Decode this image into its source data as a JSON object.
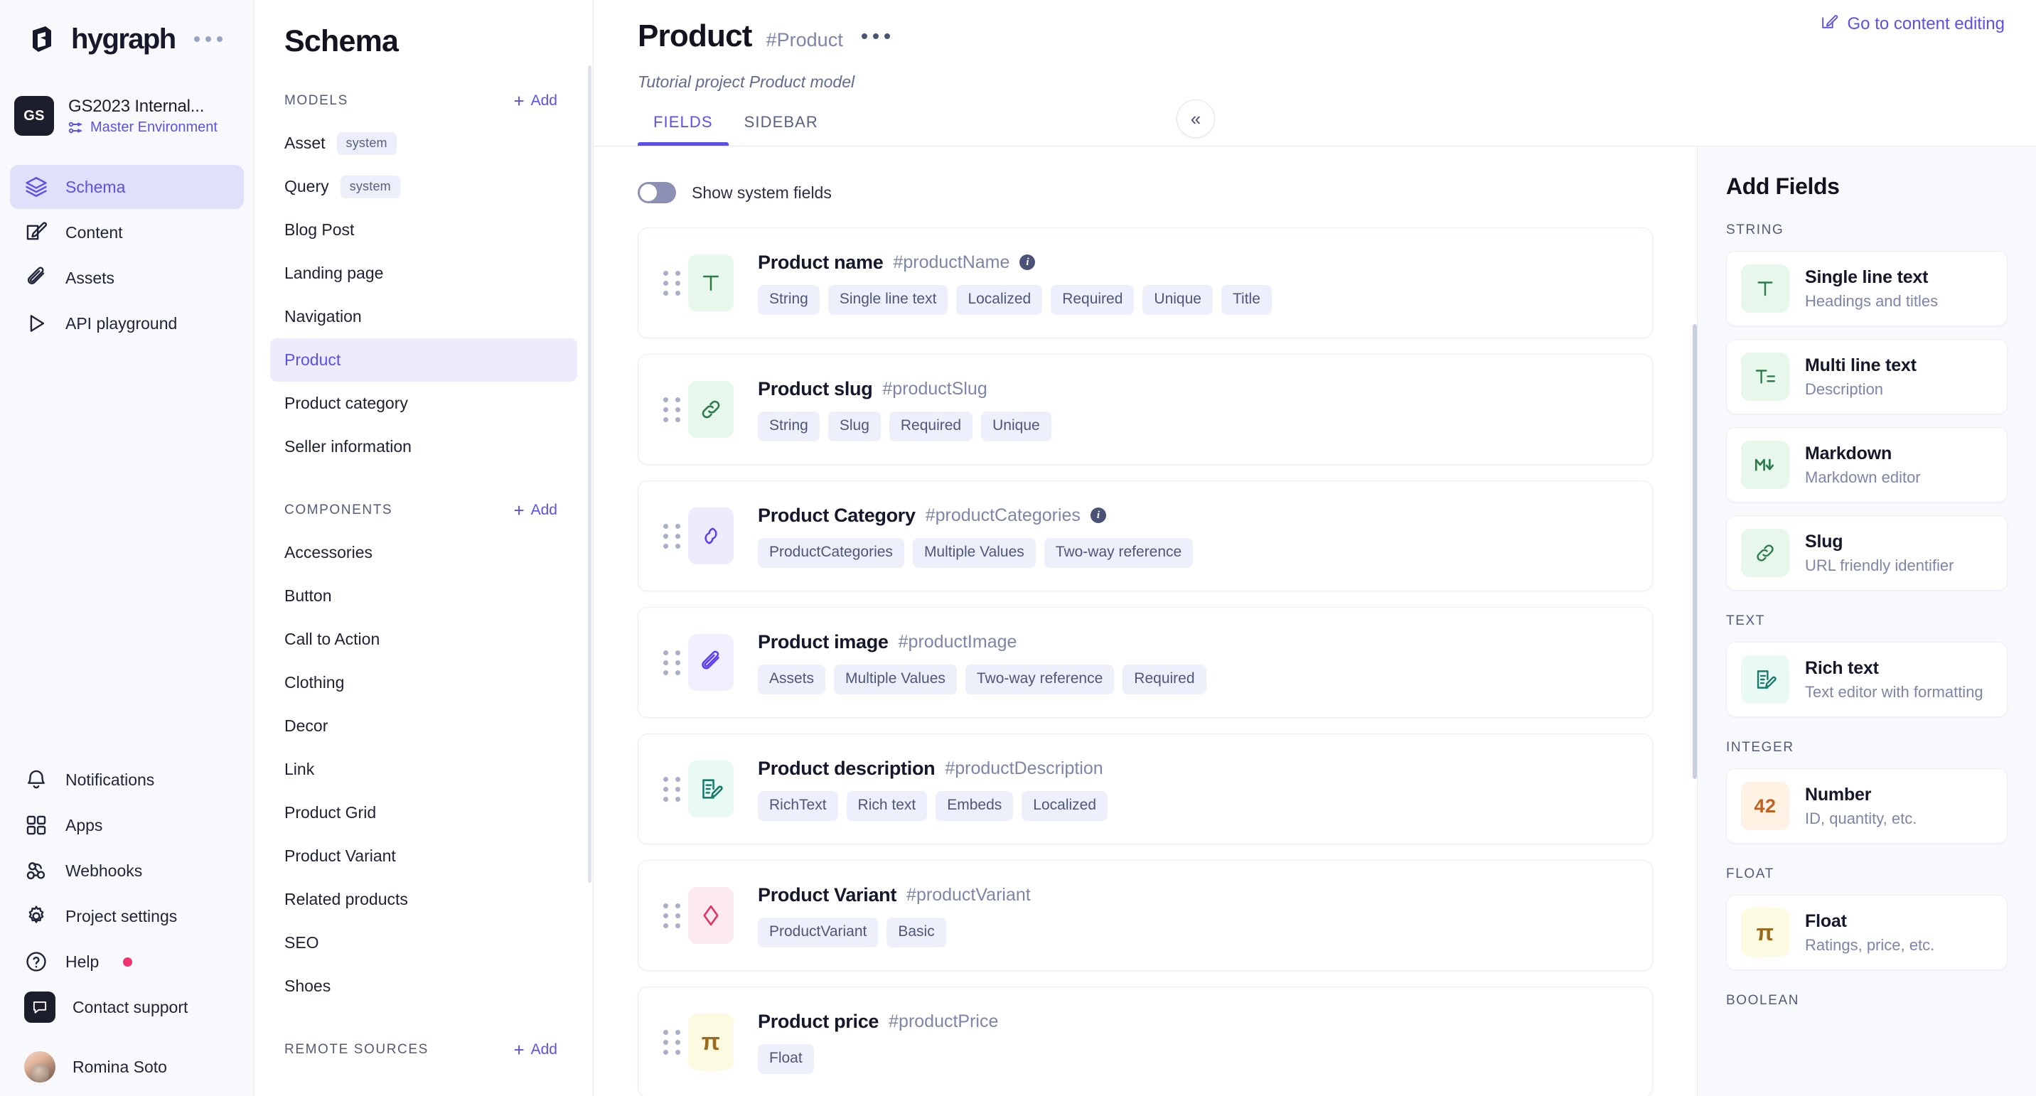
{
  "brand": {
    "name": "hygraph",
    "accent": "#5b51e8"
  },
  "project": {
    "initials": "GS",
    "name": "GS2023 Internal...",
    "environment": "Master Environment"
  },
  "nav_primary": [
    {
      "label": "Schema",
      "icon": "layers-icon",
      "active": true
    },
    {
      "label": "Content",
      "icon": "pencil-square-icon",
      "active": false
    },
    {
      "label": "Assets",
      "icon": "paperclip-icon",
      "active": false
    },
    {
      "label": "API playground",
      "icon": "play-icon",
      "active": false
    }
  ],
  "nav_secondary": [
    {
      "label": "Notifications",
      "icon": "bell-icon",
      "badge": false
    },
    {
      "label": "Apps",
      "icon": "grid-icon",
      "badge": false
    },
    {
      "label": "Webhooks",
      "icon": "webhook-icon",
      "badge": false
    },
    {
      "label": "Project settings",
      "icon": "gear-icon",
      "badge": false
    },
    {
      "label": "Help",
      "icon": "question-circle-icon",
      "badge": true
    },
    {
      "label": "Contact support",
      "icon": "chat-icon",
      "badge": false
    }
  ],
  "user": {
    "name": "Romina Soto"
  },
  "schema": {
    "title": "Schema",
    "groups": [
      {
        "label": "MODELS",
        "add_label": "Add",
        "items": [
          {
            "label": "Asset",
            "badge": "system",
            "active": false
          },
          {
            "label": "Query",
            "badge": "system",
            "active": false
          },
          {
            "label": "Blog Post",
            "badge": "",
            "active": false
          },
          {
            "label": "Landing page",
            "badge": "",
            "active": false
          },
          {
            "label": "Navigation",
            "badge": "",
            "active": false
          },
          {
            "label": "Product",
            "badge": "",
            "active": true
          },
          {
            "label": "Product category",
            "badge": "",
            "active": false
          },
          {
            "label": "Seller information",
            "badge": "",
            "active": false
          }
        ]
      },
      {
        "label": "COMPONENTS",
        "add_label": "Add",
        "items": [
          {
            "label": "Accessories",
            "badge": "",
            "active": false
          },
          {
            "label": "Button",
            "badge": "",
            "active": false
          },
          {
            "label": "Call to Action",
            "badge": "",
            "active": false
          },
          {
            "label": "Clothing",
            "badge": "",
            "active": false
          },
          {
            "label": "Decor",
            "badge": "",
            "active": false
          },
          {
            "label": "Link",
            "badge": "",
            "active": false
          },
          {
            "label": "Product Grid",
            "badge": "",
            "active": false
          },
          {
            "label": "Product Variant",
            "badge": "",
            "active": false
          },
          {
            "label": "Related products",
            "badge": "",
            "active": false
          },
          {
            "label": "SEO",
            "badge": "",
            "active": false
          },
          {
            "label": "Shoes",
            "badge": "",
            "active": false
          }
        ]
      },
      {
        "label": "REMOTE SOURCES",
        "add_label": "Add",
        "items": []
      }
    ]
  },
  "header": {
    "title": "Product",
    "api_id": "#Product",
    "description": "Tutorial project Product model",
    "content_link": "Go to content editing",
    "tabs": [
      {
        "label": "FIELDS",
        "active": true
      },
      {
        "label": "SIDEBAR",
        "active": false
      }
    ]
  },
  "fields_toolbar": {
    "show_system_fields_label": "Show system fields",
    "show_system_fields_on": false
  },
  "fields": [
    {
      "name": "Product name",
      "api_id": "#productName",
      "has_info": true,
      "icon": "text-t-icon",
      "icon_bg": "#e7f7ec",
      "icon_color": "#2f7a4d",
      "chips": [
        "String",
        "Single line text",
        "Localized",
        "Required",
        "Unique",
        "Title"
      ]
    },
    {
      "name": "Product slug",
      "api_id": "#productSlug",
      "has_info": false,
      "icon": "link-icon",
      "icon_bg": "#e7f7ec",
      "icon_color": "#2f7a4d",
      "chips": [
        "String",
        "Slug",
        "Required",
        "Unique"
      ]
    },
    {
      "name": "Product Category",
      "api_id": "#productCategories",
      "has_info": true,
      "icon": "reference-icon",
      "icon_bg": "#eeebfd",
      "icon_color": "#5b3df0",
      "chips": [
        "ProductCategories",
        "Multiple Values",
        "Two-way reference"
      ]
    },
    {
      "name": "Product image",
      "api_id": "#productImage",
      "has_info": false,
      "icon": "paperclip-icon",
      "icon_bg": "#f1effd",
      "icon_color": "#5b3df0",
      "chips": [
        "Assets",
        "Multiple Values",
        "Two-way reference",
        "Required"
      ]
    },
    {
      "name": "Product description",
      "api_id": "#productDescription",
      "has_info": false,
      "icon": "richtext-icon",
      "icon_bg": "#e8faf3",
      "icon_color": "#177a6a",
      "chips": [
        "RichText",
        "Rich text",
        "Embeds",
        "Localized"
      ]
    },
    {
      "name": "Product Variant",
      "api_id": "#productVariant",
      "has_info": false,
      "icon": "diamond-icon",
      "icon_bg": "#fdeaf0",
      "icon_color": "#e0315f",
      "chips": [
        "ProductVariant",
        "Basic"
      ]
    },
    {
      "name": "Product price",
      "api_id": "#productPrice",
      "has_info": false,
      "icon": "pi-icon",
      "icon_bg": "#fcfbe2",
      "icon_color": "#9a6b1e",
      "chips": [
        "Float"
      ]
    }
  ],
  "add_fields": {
    "title": "Add Fields",
    "groups": [
      {
        "label": "STRING",
        "cards": [
          {
            "name": "Single line text",
            "sub": "Headings and titles",
            "icon": "text-t-icon",
            "icon_bg": "#e7f7ec",
            "icon_color": "#2f7a4d"
          },
          {
            "name": "Multi line text",
            "sub": "Description",
            "icon": "text-lines-icon",
            "icon_bg": "#e7f7ec",
            "icon_color": "#2f7a4d"
          },
          {
            "name": "Markdown",
            "sub": "Markdown editor",
            "icon": "markdown-icon",
            "icon_bg": "#e7f7ec",
            "icon_color": "#2f7a4d"
          },
          {
            "name": "Slug",
            "sub": "URL friendly identifier",
            "icon": "link-icon",
            "icon_bg": "#e7f7ec",
            "icon_color": "#2f7a4d"
          }
        ]
      },
      {
        "label": "TEXT",
        "cards": [
          {
            "name": "Rich text",
            "sub": "Text editor with formatting",
            "icon": "richtext-icon",
            "icon_bg": "#e8faf3",
            "icon_color": "#177a6a"
          }
        ]
      },
      {
        "label": "INTEGER",
        "cards": [
          {
            "name": "Number",
            "sub": "ID, quantity, etc.",
            "icon": "number-42-icon",
            "icon_bg": "#fdf2e4",
            "icon_color": "#c2601f",
            "glyph": "42"
          }
        ]
      },
      {
        "label": "FLOAT",
        "cards": [
          {
            "name": "Float",
            "sub": "Ratings, price, etc.",
            "icon": "pi-icon",
            "icon_bg": "#fcfbe2",
            "icon_color": "#9a6b1e",
            "glyph": "π"
          }
        ]
      },
      {
        "label": "BOOLEAN",
        "cards": []
      }
    ]
  }
}
